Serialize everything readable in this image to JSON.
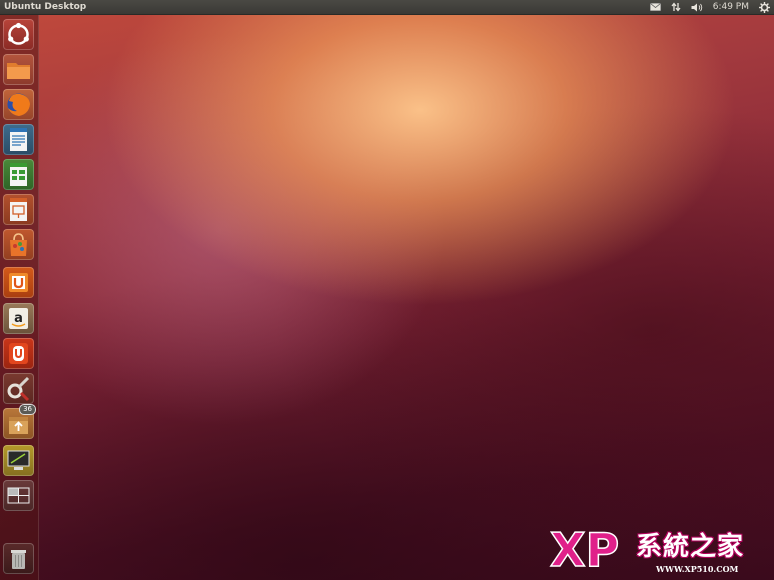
{
  "panel": {
    "title": "Ubuntu Desktop",
    "clock": "6:49 PM",
    "indicators": [
      "mail-icon",
      "network-icon",
      "volume-icon",
      "gear-icon"
    ]
  },
  "launcher": {
    "items": [
      {
        "name": "ubuntu-dash-button",
        "icon": "ubuntu-logo-icon"
      },
      {
        "name": "launcher-home-folder",
        "icon": "folder-icon"
      },
      {
        "name": "launcher-firefox",
        "icon": "firefox-icon"
      },
      {
        "name": "launcher-libreoffice-writer",
        "icon": "writer-icon"
      },
      {
        "name": "launcher-libreoffice-calc",
        "icon": "calc-icon"
      },
      {
        "name": "launcher-libreoffice-impress",
        "icon": "impress-icon"
      },
      {
        "name": "launcher-software-center",
        "icon": "shopping-bag-icon"
      },
      {
        "name": "launcher-ubuntu-one",
        "icon": "ubuntu-one-icon"
      },
      {
        "name": "launcher-amazon",
        "icon": "amazon-icon"
      },
      {
        "name": "launcher-ubuntu-one-music",
        "icon": "ubuntu-one-music-icon"
      },
      {
        "name": "launcher-system-settings",
        "icon": "settings-tools-icon"
      },
      {
        "name": "launcher-update-manager",
        "icon": "update-box-icon",
        "badge": "36"
      },
      {
        "name": "launcher-screen-app",
        "icon": "screen-icon"
      },
      {
        "name": "launcher-workspace-switcher",
        "icon": "workspace-switcher-icon"
      },
      {
        "name": "launcher-trash",
        "icon": "trash-icon"
      }
    ]
  },
  "watermark": {
    "logo": "XP",
    "chinese": "系統之家",
    "url": "WWW.XP510.COM",
    "brand_color": "#e0208a"
  }
}
